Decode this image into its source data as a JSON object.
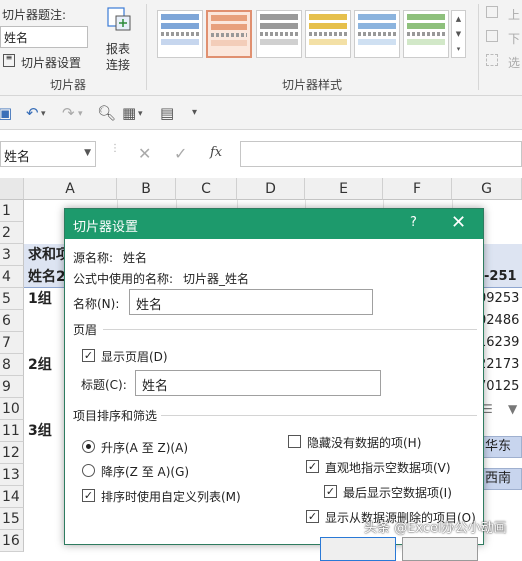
{
  "ribbon": {
    "caption_label": "切片器题注:",
    "caption_value": "姓名",
    "settings_button": "切片器设置",
    "report_connections_line1": "报表",
    "report_connections_line2": "连接",
    "group_slicer": "切片器",
    "group_styles": "切片器样式",
    "bring_forward": "上",
    "send_backward": "下",
    "selection_pane": "选"
  },
  "formula_bar": {
    "name_box": "姓名",
    "formula": ""
  },
  "grid": {
    "columns": [
      "A",
      "B",
      "C",
      "D",
      "E",
      "F",
      "G"
    ],
    "rows": [
      "1",
      "2",
      "3",
      "4",
      "5",
      "6",
      "7",
      "8",
      "9",
      "10",
      "11",
      "12",
      "13",
      "14",
      "15",
      "16"
    ],
    "cells": {
      "a3": "求和项",
      "a4": "姓名2",
      "a5": "1组",
      "a8": "2组",
      "a11": "3组",
      "g4": "-251",
      "g5": "09253",
      "g6": "02486",
      "g7": "16239",
      "g8": "22173",
      "g9": "70125"
    },
    "region_buttons": [
      "华东",
      "西南"
    ]
  },
  "dialog": {
    "title": "切片器设置",
    "help": "?",
    "close": "✕",
    "source_name_label": "源名称:",
    "source_name_value": "姓名",
    "formula_name_label": "公式中使用的名称:",
    "formula_name_value": "切片器_姓名",
    "name_label": "名称(N):",
    "name_value": "姓名",
    "header_section": "页眉",
    "show_header": "显示页眉(D)",
    "show_header_checked": true,
    "caption_label": "标题(C):",
    "caption_value": "姓名",
    "sort_section": "项目排序和筛选",
    "ascending": "升序(A 至 Z)(A)",
    "ascending_selected": true,
    "descending": "降序(Z 至 A)(G)",
    "descending_selected": false,
    "custom_lists": "排序时使用自定义列表(M)",
    "custom_lists_checked": true,
    "hide_no_data": "隐藏没有数据的项(H)",
    "hide_no_data_checked": false,
    "indicate_no_data": "直观地指示空数据项(V)",
    "indicate_no_data_checked": true,
    "show_no_data_last": "最后显示空数据项(I)",
    "show_no_data_last_checked": true,
    "show_deleted": "显示从数据源删除的项目(O)",
    "show_deleted_checked": true
  },
  "watermark": "头条 @Excel办公小动画",
  "colors": {
    "dialog_title_bg": "#1d9a6c",
    "selected_style": "#e09070"
  }
}
